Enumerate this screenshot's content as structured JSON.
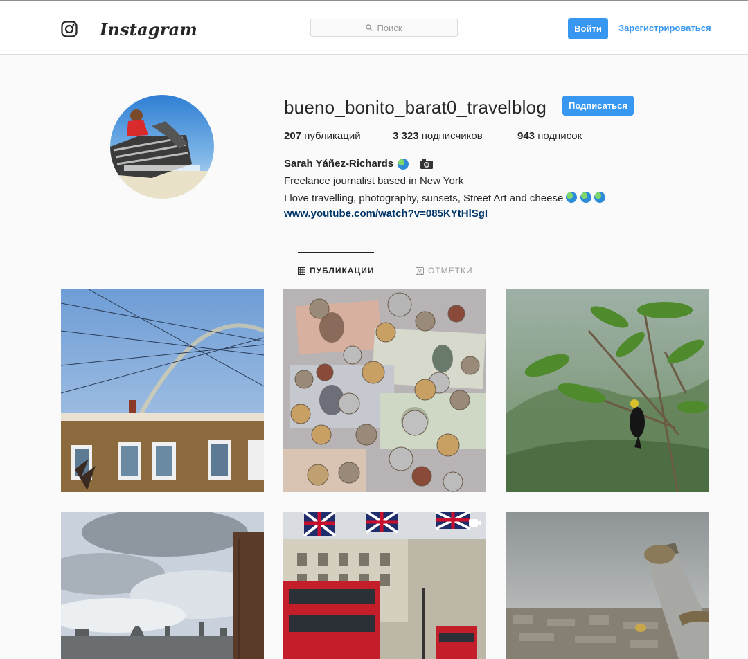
{
  "header": {
    "brand": "Instagram",
    "search_placeholder": "Поиск",
    "login_label": "Войти",
    "signup_label": "Зарегистрироваться"
  },
  "profile": {
    "username": "bueno_bonito_barat0_travelblog",
    "follow_label": "Подписаться",
    "stats": [
      {
        "value": "207",
        "label": "публикаций"
      },
      {
        "value": "3 323",
        "label": "подписчиков"
      },
      {
        "value": "943",
        "label": "подписок"
      }
    ],
    "full_name": "Sarah Yáñez-Richards",
    "bio_lines": [
      "Freelance journalist based in New York",
      "I love travelling, photography, sunsets, Street Art and cheese"
    ],
    "link": "www.youtube.com/watch?v=085KYtHlSgI"
  },
  "tabs": [
    {
      "label": "ПУБЛИКАЦИИ",
      "active": true
    },
    {
      "label": "ОТМЕТКИ",
      "active": false
    }
  ],
  "colors": {
    "accent": "#3897f0",
    "link": "#003569",
    "text": "#262626",
    "muted": "#999999"
  },
  "posts": [
    {
      "subject": "rainbow over brick building"
    },
    {
      "subject": "banknotes and coins"
    },
    {
      "subject": "bird on tree branch"
    },
    {
      "subject": "cloudy city skyline"
    },
    {
      "subject": "red double-decker buses with union flags",
      "video": true
    },
    {
      "subject": "telescope overlooking city"
    }
  ]
}
